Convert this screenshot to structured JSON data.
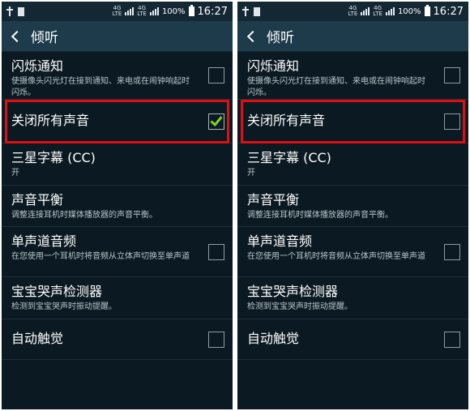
{
  "status_bar": {
    "battery": "100%",
    "time": "16:27",
    "net1_top": "4G",
    "net1_bottom": "LTE",
    "net2_top": "4G",
    "net2_bottom": "LTE"
  },
  "header": {
    "title": "倾听"
  },
  "items": [
    {
      "title": "闪烁通知",
      "subtitle": "使摄像头闪光灯在接到通知、来电或在闹钟响起时闪烁。"
    },
    {
      "title": "关闭所有声音",
      "subtitle": ""
    },
    {
      "title": "三星字幕 (CC)",
      "subtitle": "开"
    },
    {
      "title": "声音平衡",
      "subtitle": "调整连接耳机时媒体播放器的声音平衡。"
    },
    {
      "title": "单声道音频",
      "subtitle": "在您使用一个耳机时将音频从立体声切换至单声道"
    },
    {
      "title": "宝宝哭声检测器",
      "subtitle": "检测到宝宝哭声时振动提醒。"
    },
    {
      "title": "自动触觉",
      "subtitle": ""
    }
  ],
  "panels": {
    "left": {
      "mute_all_checked": true
    },
    "right": {
      "mute_all_checked": false
    }
  },
  "colors": {
    "highlight": "#e20d12",
    "check": "#7ed321",
    "appbar": "#1d3b4a",
    "background": "#0b1a22"
  }
}
